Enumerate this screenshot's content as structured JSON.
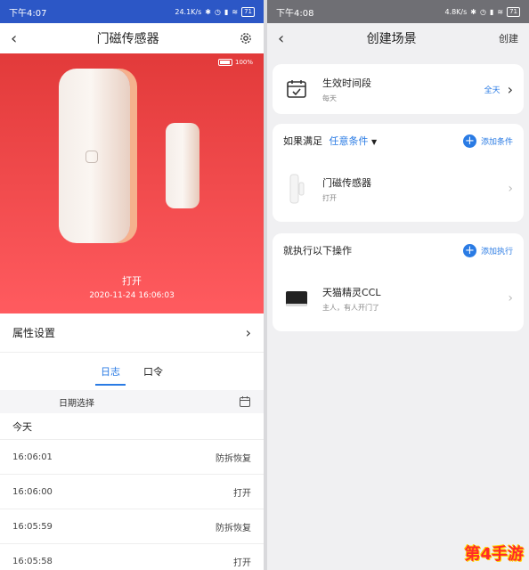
{
  "left": {
    "status": {
      "time": "下午4:07",
      "speed": "24.1K/s",
      "battery": "71"
    },
    "nav": {
      "title": "门磁传感器"
    },
    "hero": {
      "battery_pct": "100%",
      "state": "打开",
      "time": "2020-11-24 16:06:03"
    },
    "settings_label": "属性设置",
    "tabs": [
      "日志",
      "口令"
    ],
    "date_filter": "日期选择",
    "today_label": "今天",
    "logs": [
      {
        "time": "16:06:01",
        "event": "防拆恢复"
      },
      {
        "time": "16:06:00",
        "event": "打开"
      },
      {
        "time": "16:05:59",
        "event": "防拆恢复"
      },
      {
        "time": "16:05:58",
        "event": "打开"
      }
    ]
  },
  "right": {
    "status": {
      "time": "下午4:08",
      "speed": "4.8K/s",
      "battery": "71"
    },
    "nav": {
      "title": "创建场景",
      "action": "创建"
    },
    "time_card": {
      "title": "生效时间段",
      "subtitle": "每天",
      "value": "全天"
    },
    "condition": {
      "prefix": "如果满足",
      "mode": "任意条件",
      "add": "添加条件",
      "device": "门磁传感器",
      "state": "打开"
    },
    "action": {
      "title": "就执行以下操作",
      "add": "添加执行",
      "device": "天猫精灵CCL",
      "detail": "主人，有人开门了"
    }
  },
  "watermark": "第4手游",
  "colors": {
    "hero_red": "#e23a3a",
    "accent_blue": "#2a7be4"
  }
}
